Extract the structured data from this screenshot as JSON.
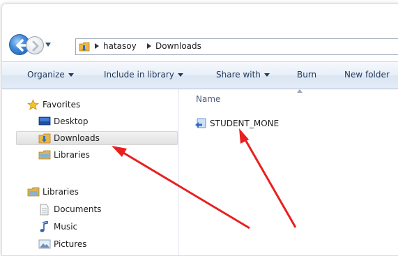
{
  "address_bar": {
    "crumbs": [
      "hatasoy",
      "Downloads"
    ]
  },
  "toolbar": {
    "organize": "Organize",
    "include_in_library": "Include in library",
    "share_with": "Share with",
    "burn": "Burn",
    "new_folder": "New folder"
  },
  "nav_pane": {
    "favorites_header": "Favorites",
    "favorites": [
      "Desktop",
      "Downloads",
      "Libraries"
    ],
    "selected": "Downloads",
    "libraries_header": "Libraries",
    "libraries": [
      "Documents",
      "Music",
      "Pictures"
    ]
  },
  "file_list": {
    "column_name": "Name",
    "files": [
      "STUDENT_MONE"
    ]
  },
  "colors": {
    "toolbar_text": "#1e395b",
    "annotation_arrow": "#e8201e",
    "column_header_text": "#4c607a"
  },
  "icons": {
    "back": "back-arrow-icon",
    "forward": "forward-arrow-icon",
    "folder": "folder-icon",
    "star": "star-icon",
    "desktop": "desktop-icon",
    "downloads": "downloads-folder-icon",
    "libraries": "library-icon",
    "documents": "document-icon",
    "music": "music-note-icon",
    "pictures": "pictures-icon",
    "file": "shortcut-file-icon"
  }
}
